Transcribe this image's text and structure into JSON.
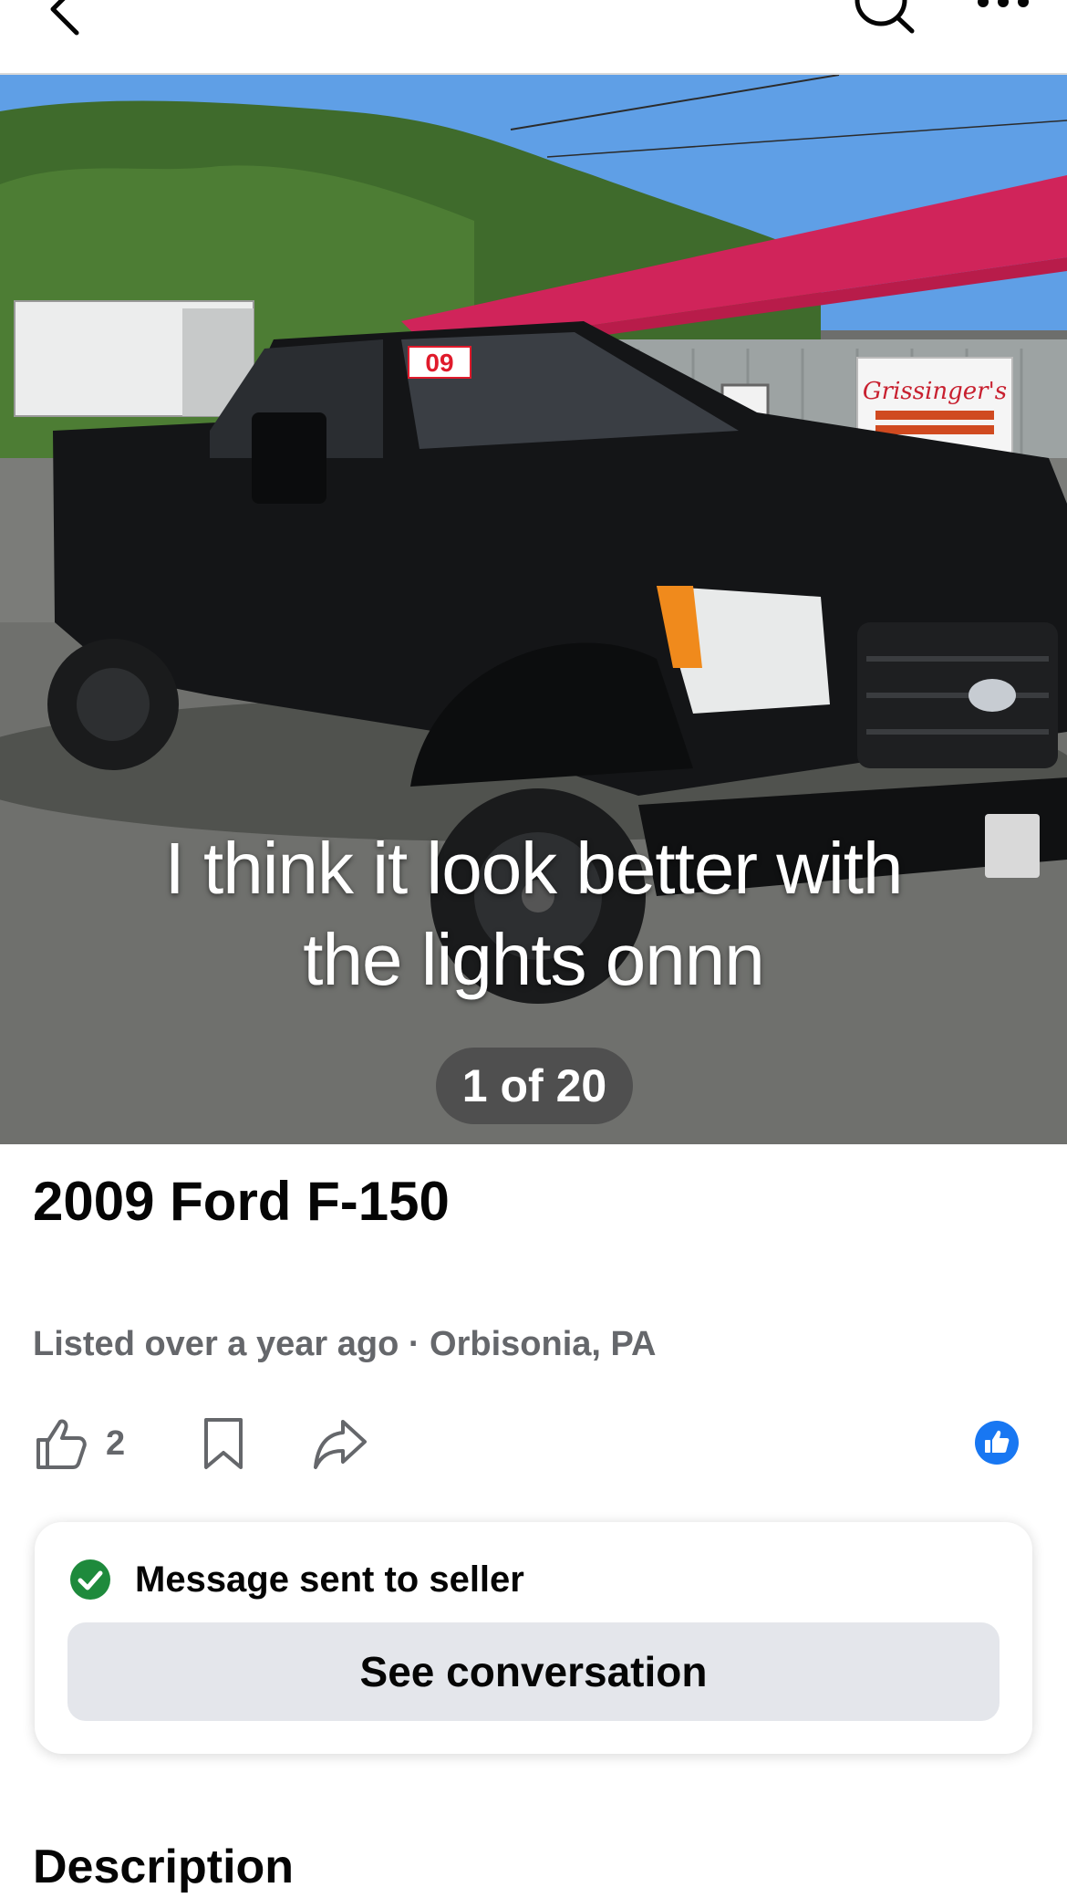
{
  "nav": {
    "back_icon": "chevron-left-icon",
    "search_icon": "search-icon",
    "more_icon": "more-horizontal-icon"
  },
  "photo": {
    "caption": "I think it look better with\nthe lights onnn",
    "plate_sticker": "09",
    "shop_sign": "Grissinger's",
    "counter": "1 of 20"
  },
  "listing": {
    "title": "2009 Ford F-150",
    "meta": "Listed over a year ago · Orbisonia, PA"
  },
  "actions": {
    "like_icon": "thumbs-up-icon",
    "like_count": "2",
    "save_icon": "bookmark-icon",
    "share_icon": "share-icon",
    "reaction_icon": "facebook-like-icon"
  },
  "message_card": {
    "status_icon": "check-circle-icon",
    "status_text": "Message sent to seller",
    "button_label": "See conversation"
  },
  "description": {
    "heading": "Description"
  },
  "colors": {
    "accent_blue": "#1877f2",
    "success_green": "#31a24c",
    "secondary_text": "#65676b",
    "button_gray": "#e4e6eb"
  }
}
